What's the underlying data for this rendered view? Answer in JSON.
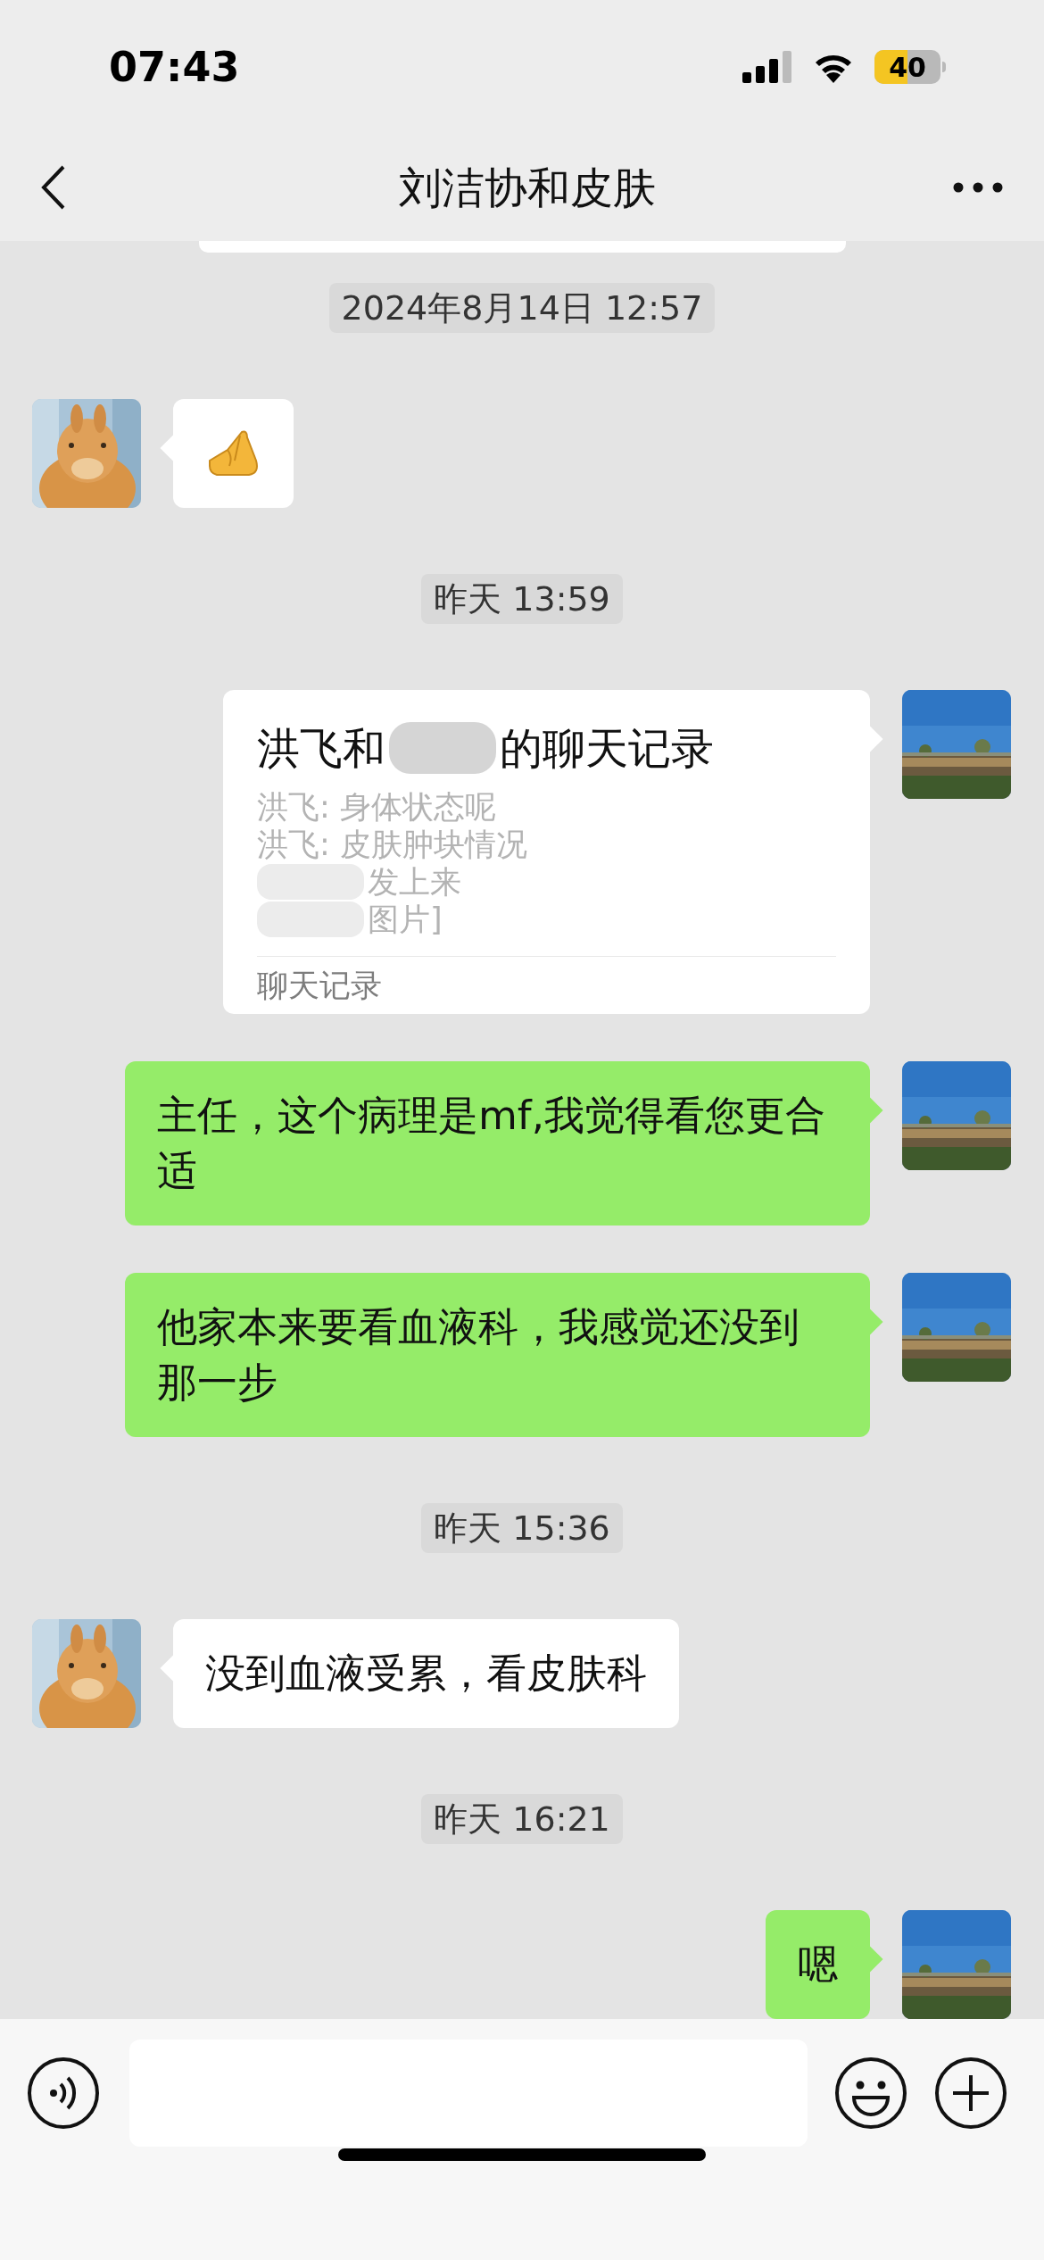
{
  "status_bar": {
    "time": "07:43",
    "battery": "40"
  },
  "nav": {
    "title": "刘洁协和皮肤"
  },
  "messages": [
    {
      "kind": "partial_bubble"
    },
    {
      "kind": "timestamp",
      "text": "2024年8月14日 12:57"
    },
    {
      "kind": "emoji",
      "outgoing": false
    },
    {
      "kind": "timestamp",
      "text": "昨天 13:59"
    },
    {
      "kind": "chat_record",
      "outgoing": true,
      "title_start": "洪飞和",
      "title_end": "的聊天记录",
      "lines": [
        "洪飞: 身体状态呢",
        "洪飞: 皮肤肿块情况",
        "发上来",
        "图片]"
      ],
      "footer": "聊天记录"
    },
    {
      "kind": "text",
      "outgoing": true,
      "text": "主任，这个病理是mf,我觉得看您更合适"
    },
    {
      "kind": "text",
      "outgoing": true,
      "text": "他家本来要看血液科，我感觉还没到那一步"
    },
    {
      "kind": "timestamp",
      "text": "昨天 15:36"
    },
    {
      "kind": "text",
      "outgoing": false,
      "text": "没到血液受累，看皮肤科"
    },
    {
      "kind": "timestamp",
      "text": "昨天 16:21"
    },
    {
      "kind": "text",
      "outgoing": true,
      "text": "嗯"
    }
  ]
}
